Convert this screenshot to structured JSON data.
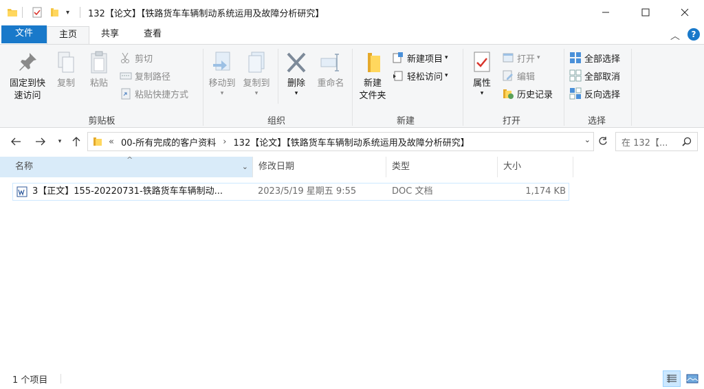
{
  "window": {
    "title": "132【论文】【铁路货车车辆制动系统运用及故障分析研究】",
    "minimize_glyph": "—",
    "maximize_glyph": "☐",
    "close_glyph": "✕"
  },
  "tabs": [
    {
      "label": "文件"
    },
    {
      "label": "主页"
    },
    {
      "label": "共享"
    },
    {
      "label": "查看"
    }
  ],
  "ribbon": {
    "clipboard": {
      "group_label": "剪贴板",
      "pin_label_1": "固定到快",
      "pin_label_2": "速访问",
      "copy_label": "复制",
      "paste_label": "粘贴",
      "cut_label": "剪切",
      "copy_path_label": "复制路径",
      "paste_shortcut_label": "粘贴快捷方式"
    },
    "organize": {
      "group_label": "组织",
      "move_to_label": "移动到",
      "copy_to_label": "复制到",
      "delete_label": "删除",
      "rename_label": "重命名"
    },
    "new": {
      "group_label": "新建",
      "new_folder_label_1": "新建",
      "new_folder_label_2": "文件夹",
      "new_item_label": "新建项目",
      "easy_access_label": "轻松访问"
    },
    "open": {
      "group_label": "打开",
      "properties_label": "属性",
      "open_label": "打开",
      "edit_label": "编辑",
      "history_label": "历史记录"
    },
    "select": {
      "group_label": "选择",
      "select_all_label": "全部选择",
      "select_none_label": "全部取消",
      "invert_label": "反向选择"
    }
  },
  "address": {
    "overflow": "«",
    "crumb_1": "00-所有完成的客户资料",
    "crumb_sep": "›",
    "crumb_2": "132【论文】【铁路货车车辆制动系统运用及故障分析研究】",
    "search_placeholder": "在 132【..."
  },
  "columns": {
    "name": "名称",
    "modified": "修改日期",
    "type": "类型",
    "size": "大小"
  },
  "files": [
    {
      "name": "3【正文】155-20220731-铁路货车车辆制动...",
      "modified": "2023/5/19 星期五 9:55",
      "type": "DOC 文档",
      "size": "1,174 KB"
    }
  ],
  "status": {
    "count": "1 个项目"
  },
  "colors": {
    "accent": "#1979ca",
    "selection_border": "#cde8ff",
    "view_active": "#cce8ff"
  }
}
